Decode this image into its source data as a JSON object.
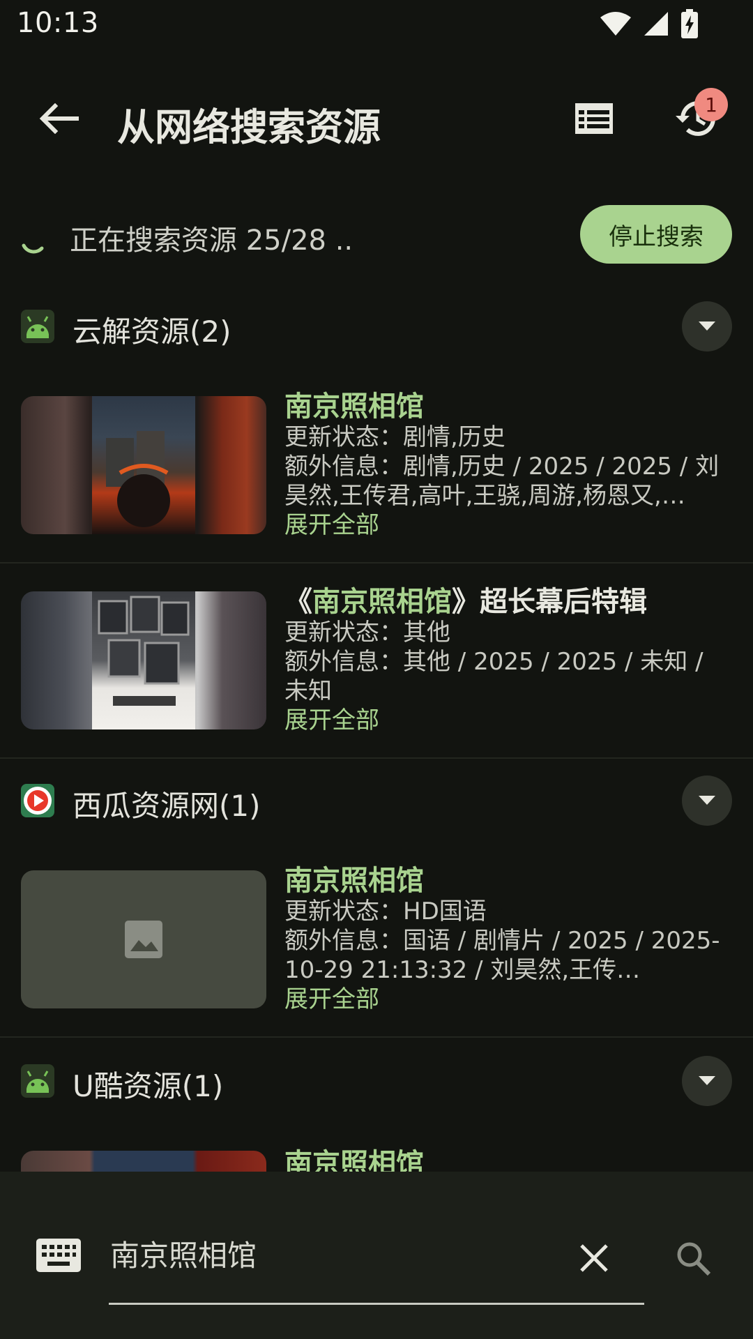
{
  "status_bar": {
    "time": "10:13"
  },
  "app_bar": {
    "title": "从网络搜索资源",
    "history_badge": "1"
  },
  "progress": {
    "text": "正在搜索资源 25/28 ..",
    "stop_label": "停止搜索"
  },
  "labels": {
    "update_status": "更新状态：",
    "extra_info": "额外信息：",
    "expand_all": "展开全部"
  },
  "sources": [
    {
      "name": "云解资源(2)",
      "icon": "android-icon",
      "results": [
        {
          "title_main": "南京照相馆",
          "update_status": "剧情,历史",
          "extra_info": "剧情,历史 / 2025 / 2025 / 刘昊然,王传君,高叶,王骁,周游,杨恩又,…"
        },
        {
          "title_prefix": "《",
          "title_main": "南京照相馆",
          "title_suffix": "》超长幕后特辑",
          "update_status": "其他",
          "extra_info": "其他 / 2025 / 2025 / 未知 / 未知"
        }
      ]
    },
    {
      "name": "西瓜资源网(1)",
      "icon": "xigua-icon",
      "results": [
        {
          "title_main": "南京照相馆",
          "update_status": "HD国语",
          "extra_info": "国语 / 剧情片 / 2025 / 2025-10-29 21:13:32 / 刘昊然,王传…"
        }
      ]
    },
    {
      "name": "U酷资源(1)",
      "icon": "android-icon",
      "results": [
        {
          "title_main": "南京照相馆"
        }
      ]
    }
  ],
  "search": {
    "value": "南京照相馆"
  },
  "colors": {
    "accent": "#a9d38f",
    "background": "#121410",
    "badge": "#f08a80"
  }
}
